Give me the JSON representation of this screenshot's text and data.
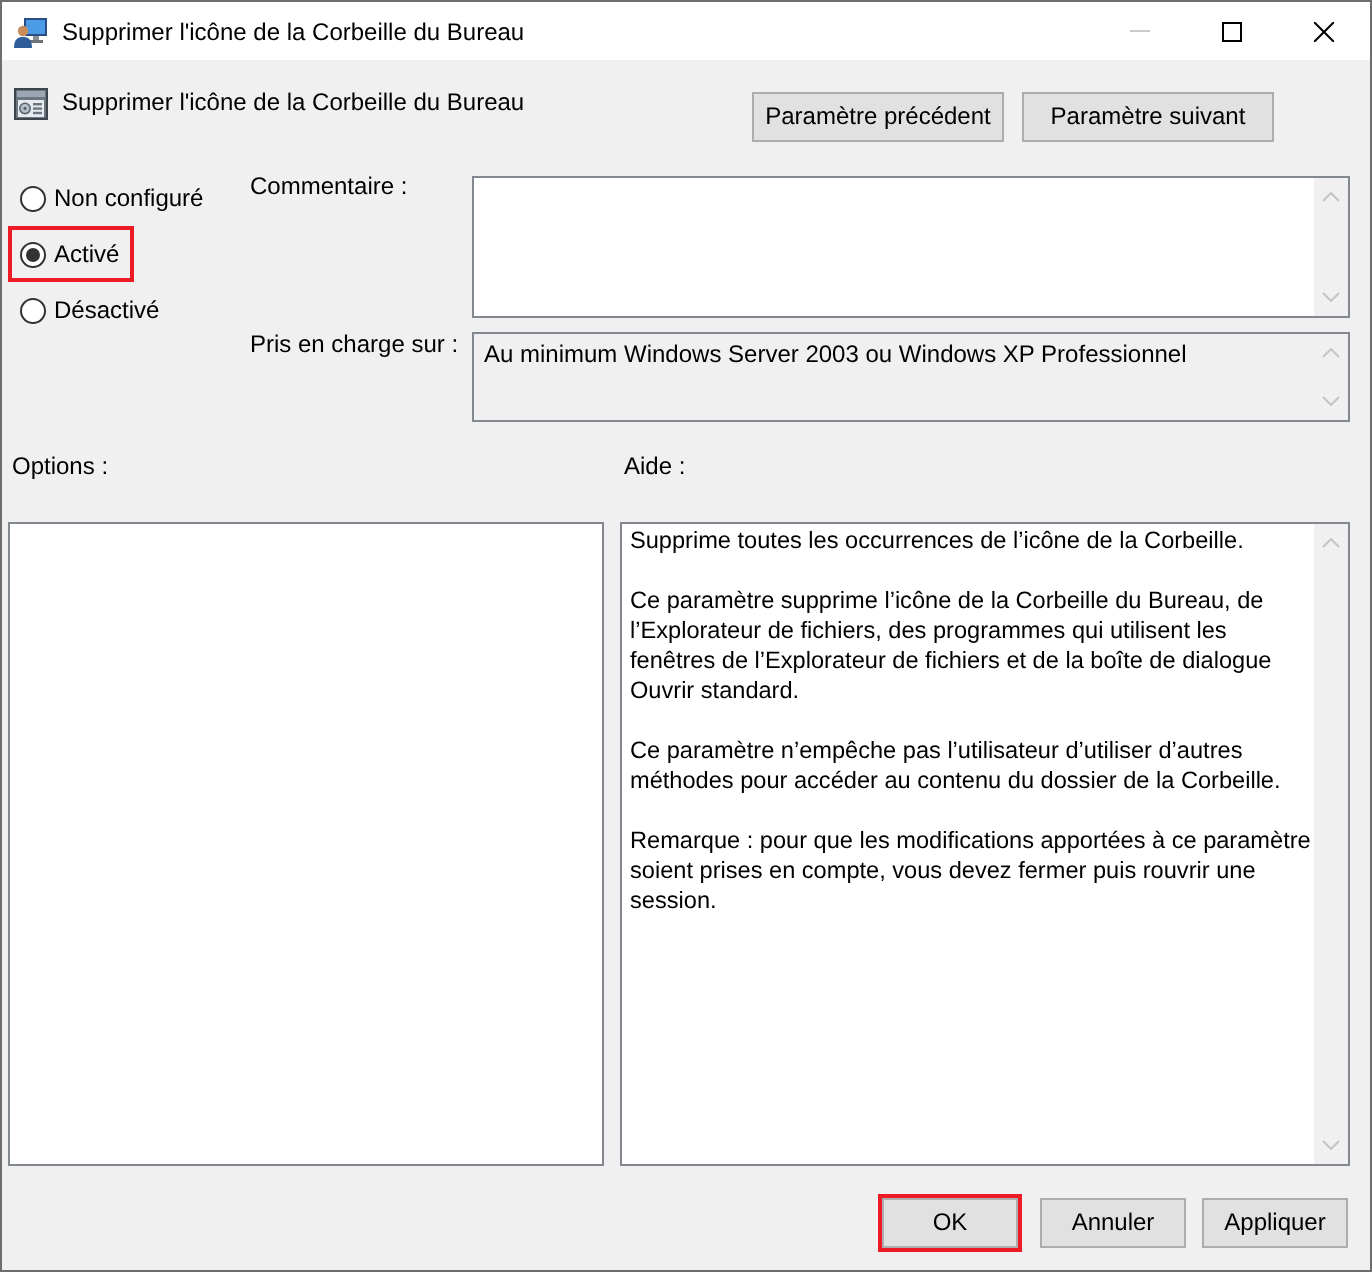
{
  "window": {
    "title": "Supprimer l'icône de la Corbeille du Bureau",
    "minimize_disabled": true
  },
  "header": {
    "title": "Supprimer l'icône de la Corbeille du Bureau",
    "buttons": [
      {
        "label": "Paramètre précédent"
      },
      {
        "label": "Paramètre suivant"
      }
    ]
  },
  "state_options": [
    {
      "label": "Non configuré",
      "selected": false,
      "highlighted": false
    },
    {
      "label": "Activé",
      "selected": true,
      "highlighted": true
    },
    {
      "label": "Désactivé",
      "selected": false,
      "highlighted": false
    }
  ],
  "comment": {
    "label": "Commentaire :"
  },
  "supported_on": {
    "label": "Pris en charge sur :",
    "value": "Au minimum Windows Server 2003 ou Windows XP Professionnel"
  },
  "options": {
    "label": "Options :"
  },
  "help": {
    "label": "Aide :",
    "paragraphs": [
      "Supprime toutes les occurrences de l’icône de la Corbeille.",
      "Ce paramètre supprime l’icône de la Corbeille du Bureau, de l’Explorateur de fichiers, des programmes qui utilisent les fenêtres de l’Explorateur de fichiers et de la boîte de dialogue Ouvrir standard.",
      "Ce paramètre n’empêche pas l’utilisateur d’utiliser d’autres méthodes pour accéder au contenu du dossier de la Corbeille.",
      "Remarque : pour que les modifications apportées à ce paramètre soient prises en compte, vous devez fermer puis rouvrir une session."
    ]
  },
  "footer_buttons": [
    {
      "label": "OK",
      "highlighted": true
    },
    {
      "label": "Annuler",
      "highlighted": false
    },
    {
      "label": "Appliquer",
      "highlighted": false
    }
  ]
}
